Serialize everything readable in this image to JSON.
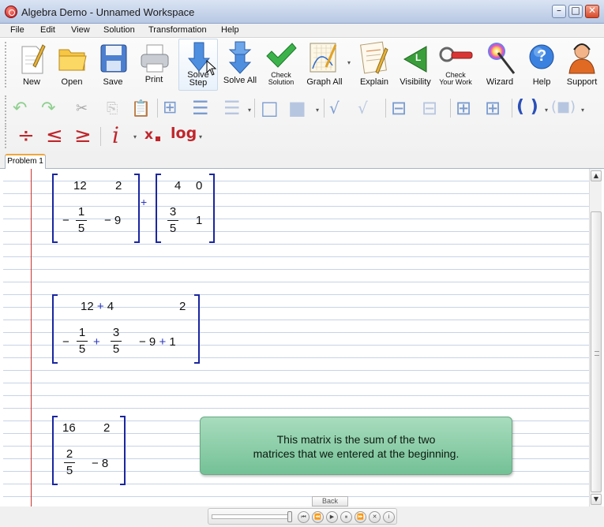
{
  "window": {
    "title": "Algebra Demo - Unnamed Workspace",
    "minimize_glyph": "–",
    "maximize_glyph": "□",
    "close_glyph": "✕"
  },
  "menu": {
    "items": [
      "File",
      "Edit",
      "View",
      "Solution",
      "Transformation",
      "Help"
    ]
  },
  "toolbar": {
    "new": "New",
    "open": "Open",
    "save": "Save",
    "print": "Print",
    "solve_step_1": "Solve",
    "solve_step_2": "Step",
    "solve_all": "Solve All",
    "check_solution_1": "Check",
    "check_solution_2": "Solution",
    "graph_all": "Graph All",
    "explain": "Explain",
    "visibility": "Visibility",
    "check_work_1": "Check",
    "check_work_2": "Your Work",
    "wizard": "Wizard",
    "help": "Help",
    "support": "Support",
    "visibility_letter": "L",
    "help_glyph": "?"
  },
  "symbols": {
    "divide": "÷",
    "less_equal": "≤",
    "greater_equal": "≥",
    "imaginary": "i",
    "subscript": "x",
    "log": "log",
    "root": "√",
    "parens": "( )"
  },
  "tabs": [
    "Problem 1"
  ],
  "workspace": {
    "matrix1": {
      "r1": [
        "12",
        "2"
      ],
      "r2": {
        "c1_sign": "−",
        "c1_num": "1",
        "c1_den": "5",
        "c2": "− 9"
      }
    },
    "plus": "+",
    "matrix2": {
      "r1": [
        "4",
        "0"
      ],
      "r2": {
        "c1_num": "3",
        "c1_den": "5",
        "c2": "1"
      }
    },
    "matrix3": {
      "r1_c1_a": "12",
      "r1_c1_op": "+",
      "r1_c1_b": "4",
      "r1_c2": "2",
      "r2_c1_sign": "−",
      "r2_c1_num1": "1",
      "r2_c1_den1": "5",
      "r2_c1_op": "+",
      "r2_c1_num2": "3",
      "r2_c1_den2": "5",
      "r2_c2_a": "− 9",
      "r2_c2_op": "+",
      "r2_c2_b": "1"
    },
    "matrix4": {
      "r1": [
        "16",
        "2"
      ],
      "r2": {
        "c1_num": "2",
        "c1_den": "5",
        "c2": "− 8"
      }
    }
  },
  "tooltip": {
    "line1": "This matrix is the sum of the two",
    "line2": "matrices that we entered at the beginning."
  },
  "bottom": {
    "back": "Back",
    "controls": [
      "⏮",
      "⏪",
      "▶",
      "⏸",
      "⏩",
      "✕",
      "i"
    ]
  },
  "colors": {
    "bracket": "#1a26a0",
    "operator_blue": "#2a36c0",
    "margin_red": "#c8352d",
    "tooltip_green": "#74c196",
    "tab_accent": "#f2a63b"
  }
}
